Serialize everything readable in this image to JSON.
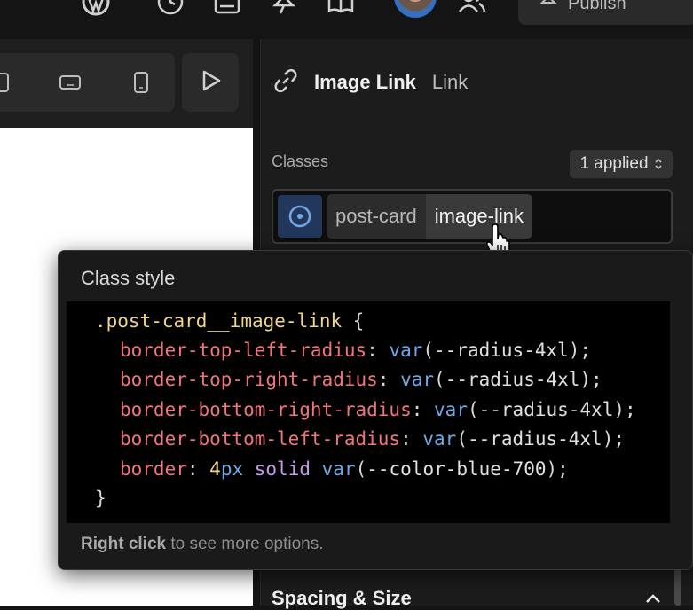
{
  "topbar": {
    "icons": [
      "wordpress-icon",
      "history-icon",
      "page-icon",
      "pin-icon",
      "book-icon",
      "users-icon"
    ],
    "publish_label": "Publish"
  },
  "canvas_toolbar": {
    "icons": [
      "desktop-icon",
      "tablet-landscape-icon",
      "mobile-icon",
      "play-icon"
    ]
  },
  "panel": {
    "title": "Image Link",
    "subtitle": "Link",
    "classes_label": "Classes",
    "applied_label": "1 applied",
    "chips": [
      "post-card",
      "image-link"
    ]
  },
  "popover": {
    "title": "Class style",
    "code": {
      "selector": ".post-card__image-link",
      "lines": [
        {
          "prop": "border-top-left-radius",
          "fn": "var",
          "arg": "--radius-4xl"
        },
        {
          "prop": "border-top-right-radius",
          "fn": "var",
          "arg": "--radius-4xl"
        },
        {
          "prop": "border-bottom-right-radius",
          "fn": "var",
          "arg": "--radius-4xl"
        },
        {
          "prop": "border-bottom-left-radius",
          "fn": "var",
          "arg": "--radius-4xl"
        }
      ],
      "border_line": {
        "prop": "border",
        "num": "4",
        "unit": "px",
        "kw": "solid",
        "fn": "var",
        "arg": "--color-blue-700"
      }
    },
    "footer_bold": "Right click",
    "footer_rest": "to see more options."
  },
  "section": {
    "spacing_title": "Spacing & Size"
  },
  "colors": {
    "accent": "#2f6fd1",
    "property": "#f2757b",
    "selector": "#f0d58a",
    "function": "#6fa8e6",
    "keyword": "#c79bea"
  }
}
